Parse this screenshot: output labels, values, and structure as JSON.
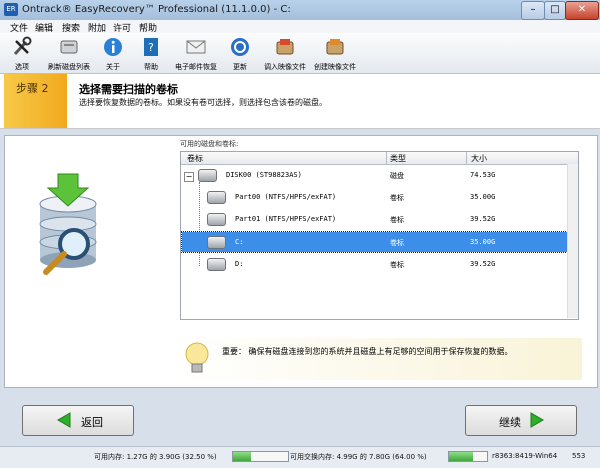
{
  "window": {
    "title": "Ontrack® EasyRecovery™ Professional (11.1.0.0) - C:",
    "app_icon": "ER"
  },
  "menubar": [
    "文件",
    "编辑",
    "搜索",
    "附加",
    "许可",
    "帮助"
  ],
  "toolbar": [
    "选项",
    "刷新磁盘列表",
    "关于",
    "帮助",
    "电子邮件恢复",
    "更新",
    "调入映像文件",
    "创建映像文件"
  ],
  "step": {
    "label": "步骤 2",
    "title": "选择需要扫描的卷标",
    "description": "选择要恢复数据的卷标。如果没有卷可选择，则选择包含该卷的磁盘。"
  },
  "disks": {
    "label": "可用的磁盘和卷标:",
    "columns": [
      "卷标",
      "类型",
      "大小"
    ],
    "rows": [
      {
        "name": "DISK00 (ST98823AS)",
        "type": "磁盘",
        "size": "74.53G",
        "selected": false
      },
      {
        "name": "Part00 (NTFS/HPFS/exFAT)",
        "type": "卷标",
        "size": "35.00G",
        "selected": false
      },
      {
        "name": "Part01 (NTFS/HPFS/exFAT)",
        "type": "卷标",
        "size": "39.52G",
        "selected": false
      },
      {
        "name": "C:",
        "type": "卷标",
        "size": "35.00G",
        "selected": true
      },
      {
        "name": "D:",
        "type": "卷标",
        "size": "39.52G",
        "selected": false
      }
    ]
  },
  "tip": {
    "text": "重要：  确保有磁盘连接到您的系统并且磁盘上有足够的空间用于保存恢复的数据。"
  },
  "buttons": {
    "back": "返回",
    "next": "继续"
  },
  "status": {
    "memory": "可用内存: 1.27G 的 3.90G (32.50 %)",
    "memory_fraction": 0.325,
    "swap": "可用交换内存: 4.99G 的 7.80G (64.00 %)",
    "swap_fraction": 0.64,
    "build": "r8363:8419-Win64",
    "code": "553"
  },
  "colors": {
    "accent": "#3d8ee8",
    "step": "#f1a91e",
    "arrow": "#2fae2a"
  }
}
